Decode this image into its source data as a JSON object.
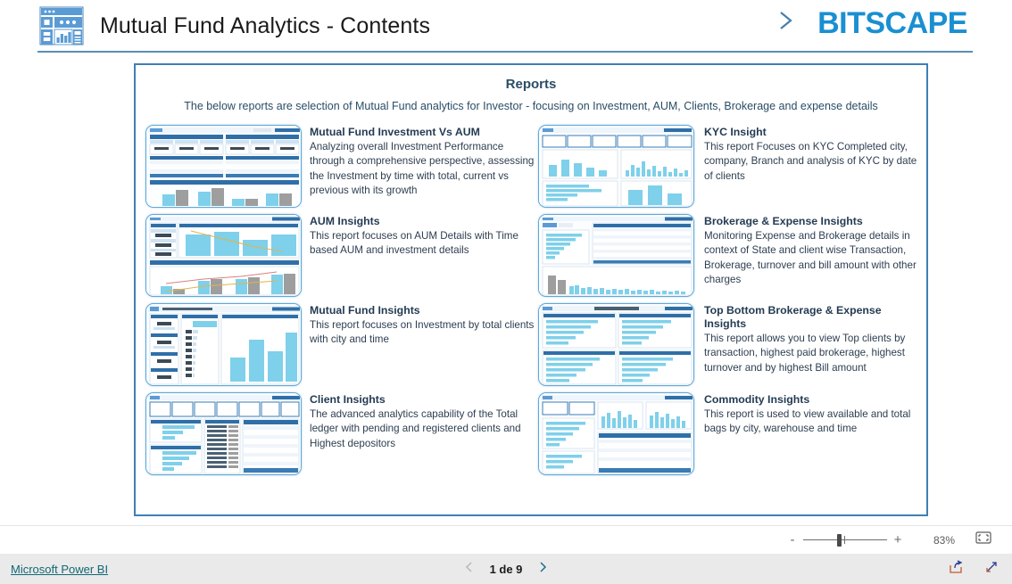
{
  "header": {
    "app_icon": "dashboard-icon",
    "title": "Mutual Fund Analytics - Contents",
    "chevron_icon": "chevron-right-icon",
    "brand": "BITSCAPE"
  },
  "report": {
    "title": "Reports",
    "subtitle": "The below reports are selection of Mutual Fund analytics for Investor - focusing on Investment, AUM, Clients, Brokerage and expense details",
    "items": [
      {
        "column": "left",
        "thumb": "thumbnail-mutual-fund-investment-vs-aum",
        "title": "Mutual Fund Investment Vs AUM",
        "description": "Analyzing overall Investment Performance through a comprehensive perspective, assessing the Investment by time with total, current vs previous with its growth"
      },
      {
        "column": "right",
        "thumb": "thumbnail-kyc-insight",
        "title": "KYC Insight",
        "description": "This report Focuses on KYC Completed city, company, Branch and analysis of KYC by date of clients"
      },
      {
        "column": "left",
        "thumb": "thumbnail-aum-insights",
        "title": "AUM Insights",
        "description": "This report focuses on AUM Details with Time based AUM and investment details"
      },
      {
        "column": "right",
        "thumb": "thumbnail-brokerage-expense-insights",
        "title": "Brokerage & Expense Insights",
        "description": "Monitoring Expense and Brokerage details in context of State and client wise Transaction, Brokerage, turnover and bill amount with other charges"
      },
      {
        "column": "left",
        "thumb": "thumbnail-mutual-fund-insights",
        "title": "Mutual Fund Insights",
        "description": "This report focuses on Investment by total clients with city and time"
      },
      {
        "column": "right",
        "thumb": "thumbnail-top-bottom-brokerage-expense-insights",
        "title": "Top Bottom Brokerage & Expense Insights",
        "description": "This report allows you to view Top clients by transaction, highest paid brokerage, highest turnover and by highest Bill amount"
      },
      {
        "column": "left",
        "thumb": "thumbnail-client-insights",
        "title": "Client Insights",
        "description": "The advanced analytics capability of the Total ledger with pending and registered clients and Highest depositors"
      },
      {
        "column": "right",
        "thumb": "thumbnail-commodity-insights",
        "title": "Commodity Insights",
        "description": "This report is used to view available and total bags by city, warehouse and time"
      }
    ]
  },
  "zoombar": {
    "minus_label": "-",
    "plus_label": "+",
    "zoom_level": "83%",
    "fit_icon": "fit-to-page-icon"
  },
  "statusbar": {
    "powerbi_link": "Microsoft Power BI",
    "prev_icon": "chevron-left-icon",
    "page_label": "1 de 9",
    "next_icon": "chevron-right-icon",
    "share_icon": "share-icon",
    "fullscreen_icon": "fullscreen-icon"
  },
  "colors": {
    "brand_blue": "#1a8fd1",
    "canvas_border": "#3f7fb5",
    "title_text": "#2a4d66",
    "link_teal": "#116973",
    "thumb_blue": "#7fd0ea",
    "thumb_gray": "#9e9e9e"
  }
}
